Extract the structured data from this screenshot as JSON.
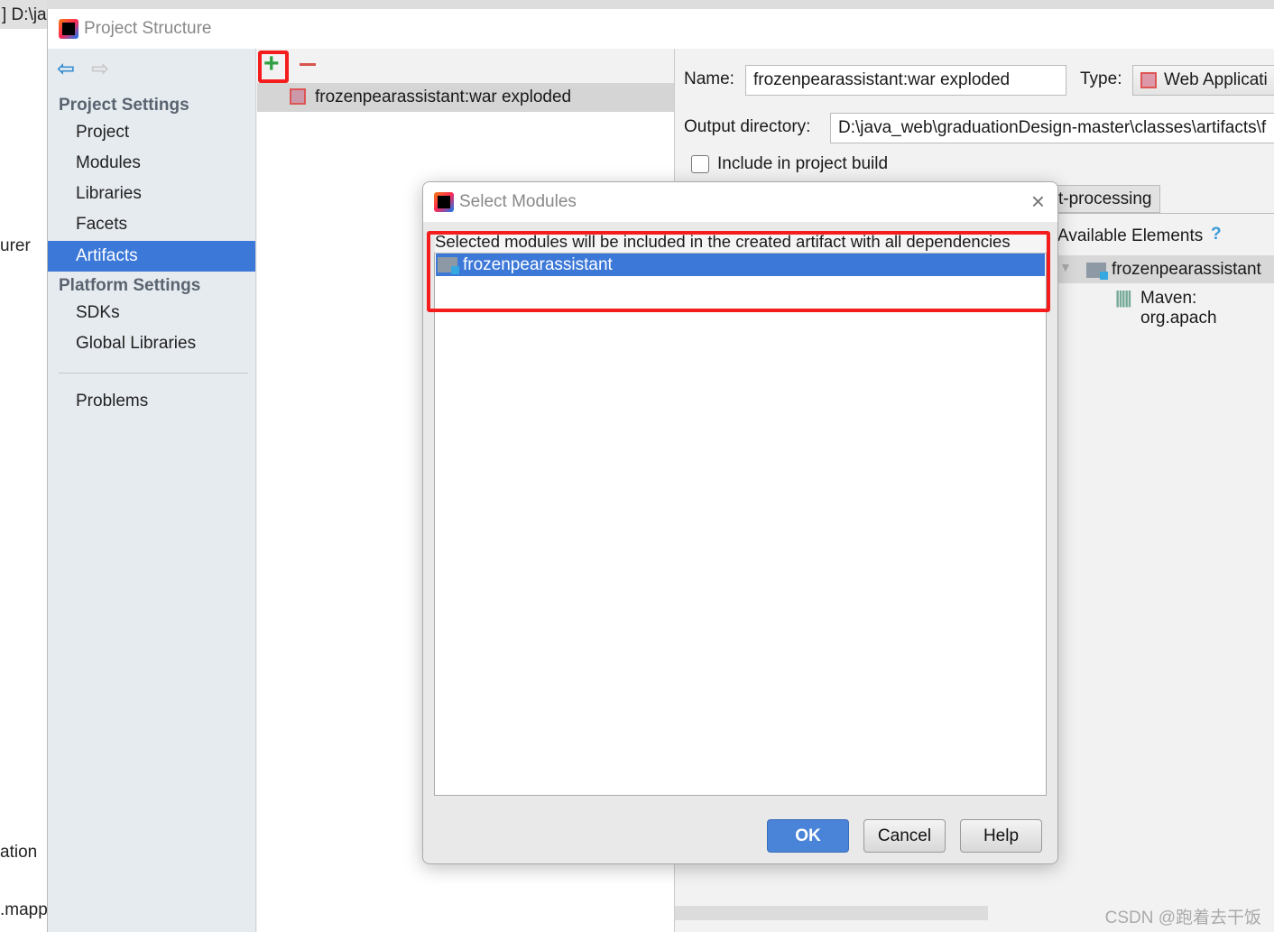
{
  "background": {
    "top_text": "] D:\\ja",
    "fragments": [
      "urer",
      "ation",
      ".mapp"
    ]
  },
  "window": {
    "title": "Project Structure"
  },
  "sidebar": {
    "project_settings": "Project Settings",
    "project_items": [
      {
        "label": "Project"
      },
      {
        "label": "Modules"
      },
      {
        "label": "Libraries"
      },
      {
        "label": "Facets"
      },
      {
        "label": "Artifacts",
        "selected": true
      }
    ],
    "platform_settings": "Platform Settings",
    "platform_items": [
      {
        "label": "SDKs"
      },
      {
        "label": "Global Libraries"
      }
    ],
    "problems": "Problems"
  },
  "artifacts": {
    "items": [
      "frozenpearassistant:war exploded"
    ]
  },
  "details": {
    "name_label": "Name:",
    "name_value": "frozenpearassistant:war exploded",
    "type_label": "Type:",
    "type_value": "Web Applicati",
    "output_label": "Output directory:",
    "output_value": "D:\\java_web\\graduationDesign-master\\classes\\artifacts\\f",
    "include_label": "Include in project build",
    "include_checked": false,
    "tab_label": "t-processing",
    "available_label": "Available Elements",
    "tree": [
      {
        "label": "frozenpearassistant"
      },
      {
        "label": "Maven: org.apach"
      }
    ]
  },
  "dialog": {
    "title": "Select Modules",
    "description": "Selected modules will be included in the created artifact with all dependencies",
    "modules": [
      {
        "label": "frozenpearassistant",
        "selected": true
      }
    ],
    "ok": "OK",
    "cancel": "Cancel",
    "help": "Help"
  },
  "watermark": "CSDN @跑着去干饭",
  "colors": {
    "accent": "#3c78d8",
    "highlight": "#f41c1c"
  }
}
